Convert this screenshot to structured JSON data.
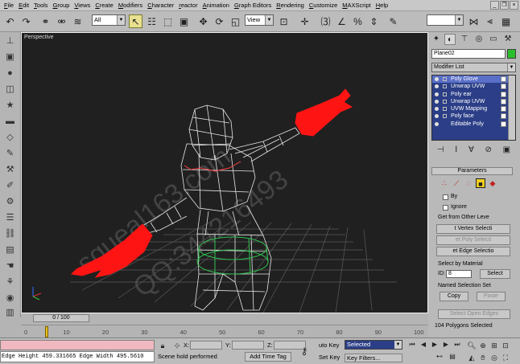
{
  "menu": {
    "items": [
      "File",
      "Edit",
      "Tools",
      "Group",
      "Views",
      "Create",
      "Modifiers",
      "Character",
      "reactor",
      "Animation",
      "Graph Editors",
      "Rendering",
      "Customize",
      "MAXScript",
      "Help"
    ]
  },
  "toolbar": {
    "selection_filter": "All",
    "reference_coord": "View"
  },
  "viewport": {
    "label": "Perspective",
    "watermark_1": "squeal163.com",
    "watermark_2": "QQ:344216493"
  },
  "command_panel": {
    "object_name": "Plane02",
    "object_color": "#2bbf2b",
    "modifier_list_label": "Modifier List",
    "stack": [
      {
        "label": "Poly Glove",
        "selected": true
      },
      {
        "label": "Unwrap UVW",
        "selected": false
      },
      {
        "label": "Poly ear",
        "selected": false
      },
      {
        "label": "Unwrap UVW",
        "selected": false
      },
      {
        "label": "UVW Mapping",
        "selected": false
      },
      {
        "label": "Poly face",
        "selected": false
      },
      {
        "label": "Editable Poly",
        "selected": false
      }
    ],
    "parameters_header": "Parameters",
    "by_label": "By",
    "ignore_label": "Ignore",
    "get_from_other_label": "Get from Other Leve",
    "get_vertex_btn": "t Vertex Selecti",
    "get_poly_btn": "et Poly Selecti",
    "get_edge_btn": "et Edge Selectio",
    "select_by_material_label": "Select by Material",
    "id_label": "ID:",
    "id_value": "8",
    "select_btn": "Select",
    "named_sel_label": "Named Selection Set",
    "copy_btn": "Copy",
    "paste_btn": "Paste",
    "select_open_edges_btn": "Select Open Edges",
    "status_text": "104 Polygons Selected"
  },
  "timeline": {
    "slider_label": "0 / 100",
    "ticks": [
      "0",
      "10",
      "20",
      "30",
      "40",
      "50",
      "60",
      "70",
      "80",
      "90",
      "100"
    ]
  },
  "statusbar": {
    "listener_output": "Edge Height 459.331665 Edge Width 495.5610",
    "prompt": "Scene hold performed",
    "add_time_tag": "Add Time Tag",
    "x_label": "X:",
    "y_label": "Y:",
    "z_label": "Z:",
    "auto_key": "uto Key",
    "selected_value": "Selected",
    "set_key": "Set Key",
    "key_filters": "Key Filters..."
  }
}
